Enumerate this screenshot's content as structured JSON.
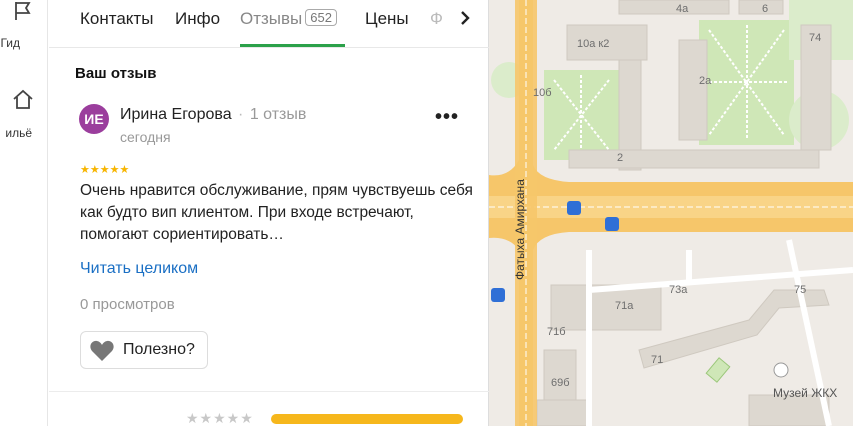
{
  "rail": {
    "items": [
      {
        "label": "Гид",
        "icon": "flag-icon"
      },
      {
        "label": "ильё",
        "icon": "house-icon"
      }
    ]
  },
  "tabs": [
    {
      "label": "Контакты"
    },
    {
      "label": "Инфо"
    },
    {
      "label": "Отзывы",
      "count": "652"
    },
    {
      "label": "Цены"
    },
    {
      "label": "Ф"
    }
  ],
  "review": {
    "section_title": "Ваш отзыв",
    "avatar_initials": "ИЕ",
    "author": "Ирина Егорова",
    "author_reviews": "1 отзыв",
    "date": "сегодня",
    "more": "•••",
    "stars": "★★★★★",
    "rating": 5,
    "text": "Очень нравится обслуживание, прям чувствуешь себя как будто вип клиентом. При входе встречают, помогают сориентировать…",
    "read_more": "Читать целиком",
    "views": "0 просмотров",
    "useful_label": "Полезно?"
  },
  "bottom": {
    "stars": "★★★★★",
    "bar_fill": 1.0
  },
  "map": {
    "street": "Фатыха Амирхана",
    "buildings": [
      "4а",
      "6",
      "74",
      "10а к2",
      "10б",
      "2а",
      "2",
      "73а",
      "75",
      "71а",
      "71б",
      "71",
      "69б"
    ],
    "museum": "Музей ЖКХ"
  },
  "colors": {
    "accent_green": "#2ca14a",
    "link": "#1a6fc4",
    "star": "#f7b500",
    "avatar": "#9b3e9d",
    "road": "#f6c66a"
  }
}
